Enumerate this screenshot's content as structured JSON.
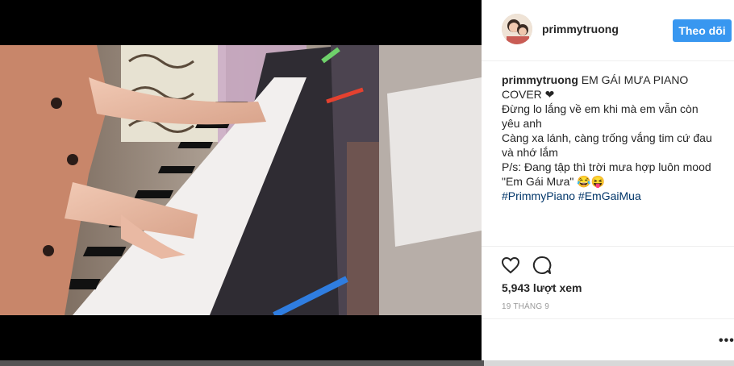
{
  "post": {
    "username": "primmytruong",
    "follow_label": "Theo dõi",
    "caption_title": "EM GÁI MƯA PIANO COVER ❤",
    "caption_lines": [
      "Đừng lo lắng về em khi mà em vẫn còn yêu anh",
      "Càng xa lánh, càng trống vắng tim cứ đau và nhớ lắm",
      "P/s: Đang tập thì trời mưa hợp luôn mood \"Em Gái Mưa\" 😂😝"
    ],
    "hashtags": [
      "#PrimmyPiano",
      "#EmGaiMua"
    ],
    "views": "5,943 lượt xem",
    "date": "19 THÁNG 9",
    "more_label": "•••"
  },
  "icons": {
    "like": "heart-outline-icon",
    "comment": "speech-bubble-icon"
  },
  "colors": {
    "accent": "#3897f0",
    "hashtag": "#003569",
    "text": "#262626",
    "muted": "#999999"
  }
}
